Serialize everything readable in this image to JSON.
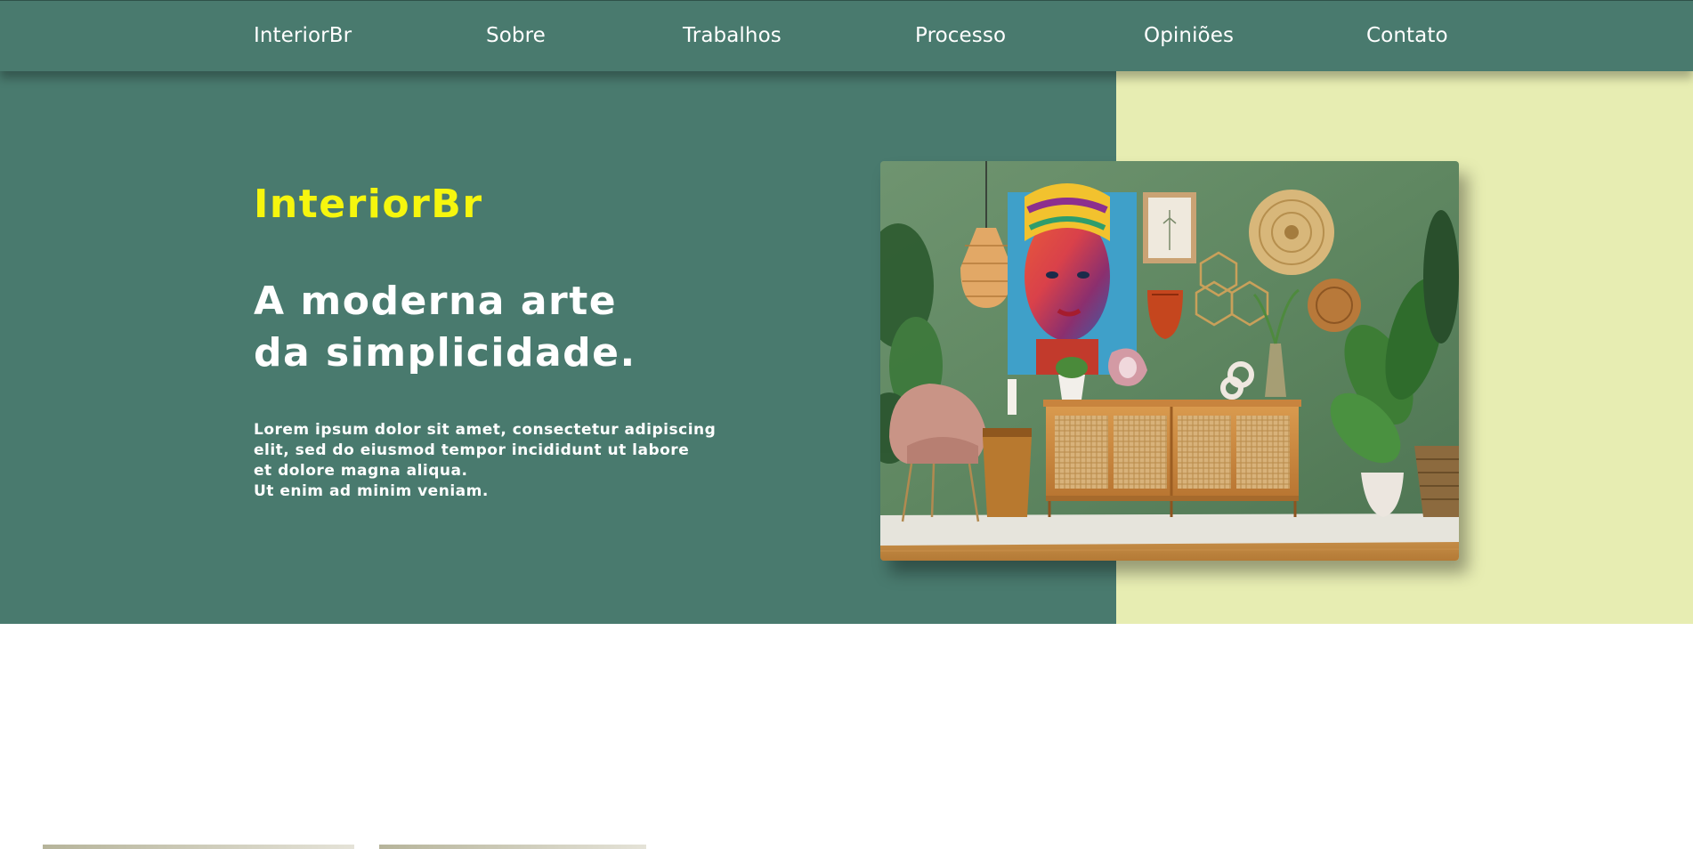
{
  "nav": {
    "brand": "InteriorBr",
    "items": [
      {
        "label": "Sobre"
      },
      {
        "label": "Trabalhos"
      },
      {
        "label": "Processo"
      },
      {
        "label": "Opiniões"
      },
      {
        "label": "Contato"
      }
    ]
  },
  "hero": {
    "brand": "InteriorBr",
    "headline_lines": [
      "A moderna arte",
      "da simplicidade."
    ],
    "body_lines": [
      "Lorem ipsum dolor sit amet, consectetur adipiscing",
      "elit, sed do eiusmod tempor incididunt ut labore",
      "et dolore magna aliqua.",
      "Ut enim ad minim veniam."
    ]
  },
  "colors": {
    "primary_green": "#497a6e",
    "accent_yellow": "#f6f60e",
    "light_lime": "#e7edb2",
    "text_white": "#ffffff"
  }
}
